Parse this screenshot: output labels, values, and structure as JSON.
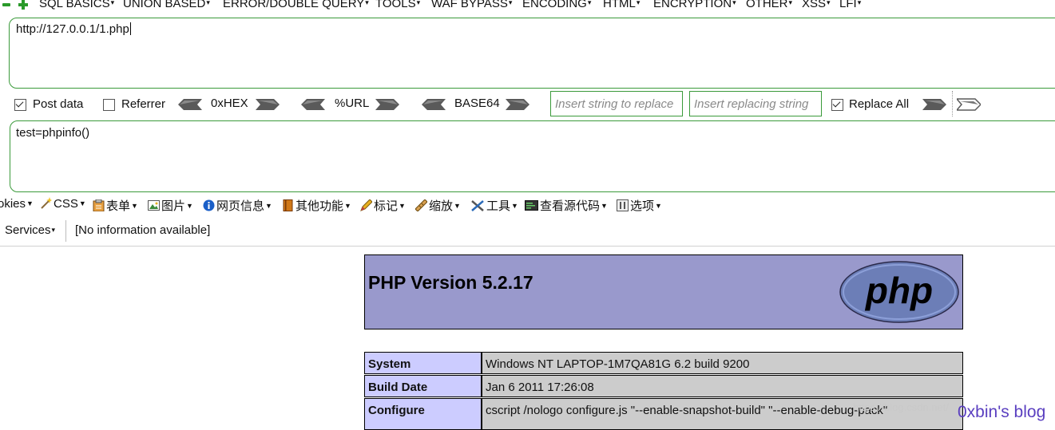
{
  "top_menu": [
    {
      "label": "SQL BASICS"
    },
    {
      "label": "UNION BASED"
    },
    {
      "label": "ERROR/DOUBLE QUERY"
    },
    {
      "label": "TOOLS"
    },
    {
      "label": "WAF BYPASS"
    },
    {
      "label": "ENCODING"
    },
    {
      "label": "HTML"
    },
    {
      "label": "ENCRYPTION"
    },
    {
      "label": "OTHER"
    },
    {
      "label": "XSS"
    },
    {
      "label": "LFI"
    }
  ],
  "url_box": {
    "value": "http://127.0.0.1/1.php"
  },
  "options": {
    "post_data": {
      "label": "Post data",
      "checked": true
    },
    "referrer": {
      "label": "Referrer",
      "checked": false
    },
    "hex": "0xHEX",
    "url": "%URL",
    "base64": "BASE64",
    "replace_find_placeholder": "Insert string to replace",
    "replace_with_placeholder": "Insert replacing string",
    "replace_all": {
      "label": "Replace All",
      "checked": true
    }
  },
  "post_box": {
    "value": "test=phpinfo()"
  },
  "webdev_toolbar": [
    {
      "label": "okies",
      "icon": "cookie-icon"
    },
    {
      "label": "CSS",
      "icon": "css-wand-icon"
    },
    {
      "label": "表单",
      "icon": "form-icon"
    },
    {
      "label": "图片",
      "icon": "image-icon"
    },
    {
      "label": "网页信息",
      "icon": "info-icon"
    },
    {
      "label": "其他功能",
      "icon": "book-icon"
    },
    {
      "label": "标记",
      "icon": "pencil-icon"
    },
    {
      "label": "缩放",
      "icon": "ruler-icon"
    },
    {
      "label": "工具",
      "icon": "tools-icon"
    },
    {
      "label": "查看源代码",
      "icon": "source-icon"
    },
    {
      "label": "选项",
      "icon": "options-icon"
    }
  ],
  "services_bar": {
    "services_label": "Services",
    "info": "[No information available]"
  },
  "php": {
    "title": "PHP Version 5.2.17",
    "logo_text": "php",
    "rows": [
      {
        "key": "System",
        "value": "Windows NT LAPTOP-1M7QA81G 6.2 build 9200"
      },
      {
        "key": "Build Date",
        "value": "Jan 6 2011 17:26:08"
      },
      {
        "key": "Configure",
        "value": "cscript /nologo configure.js \"--enable-snapshot-build\" \"--enable-debug-pack\""
      }
    ]
  },
  "watermark": "https://blog.csdn.net/",
  "blog_mark": "0xbin's blog",
  "colors": {
    "accent_green": "#3a9a3a",
    "php_header": "#9999cc",
    "php_key": "#ccccff",
    "php_value": "#cccccc"
  }
}
